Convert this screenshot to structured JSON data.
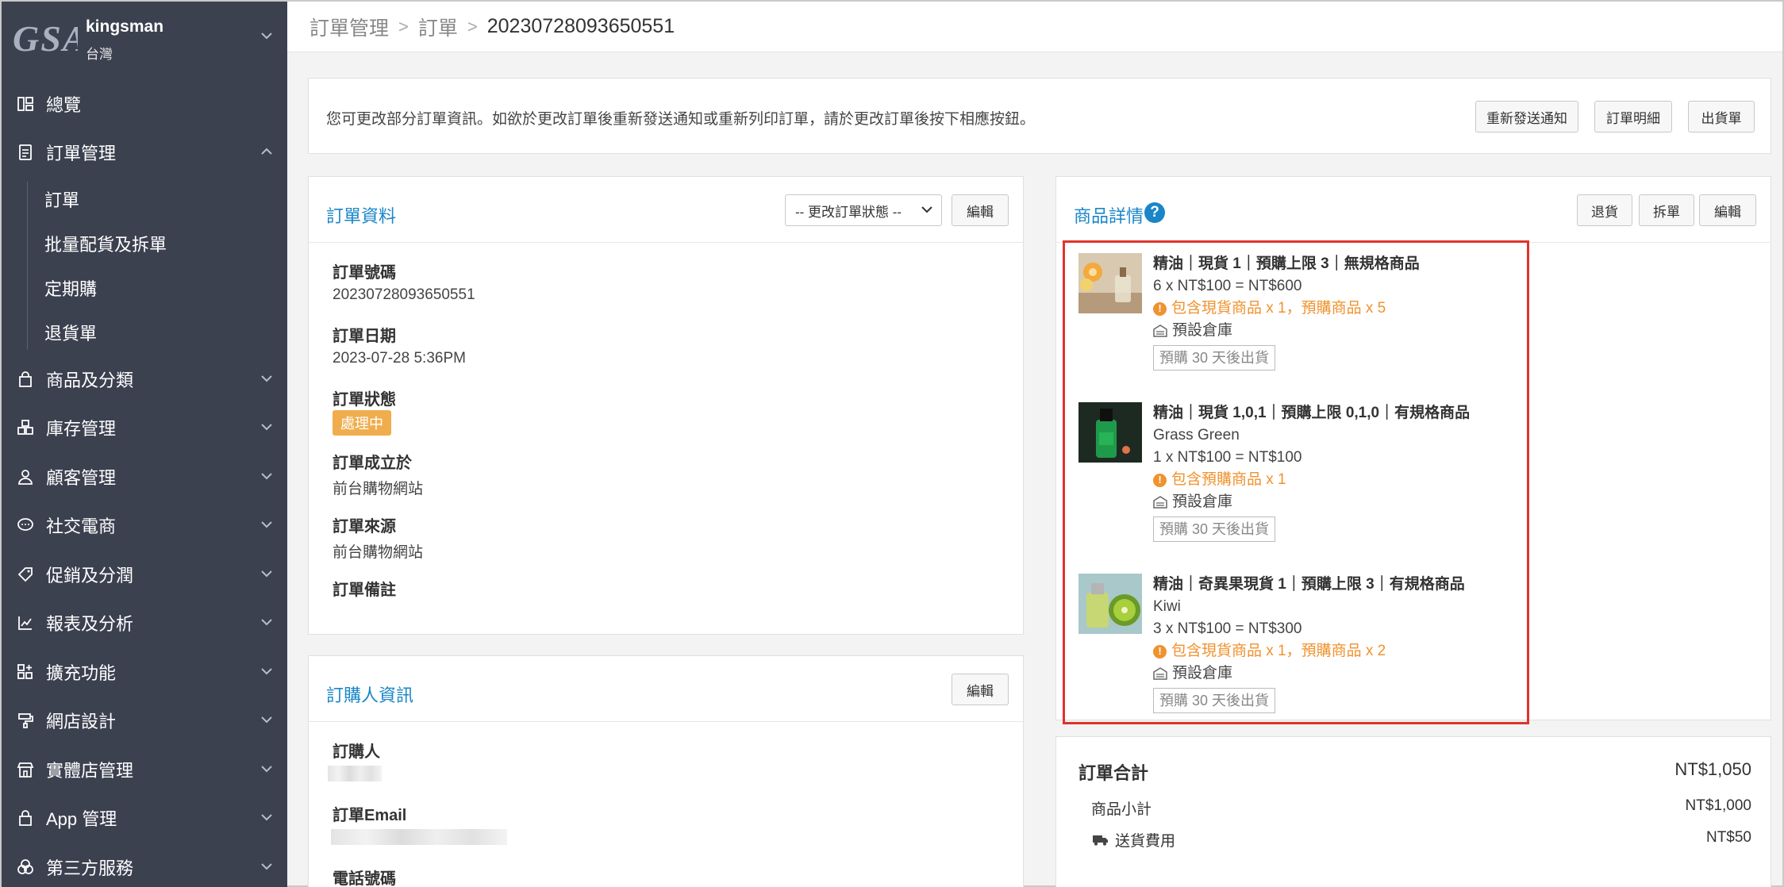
{
  "sidebar": {
    "logo_text": "GSA",
    "store_name": "kingsman",
    "store_region": "台灣",
    "items": [
      {
        "label": "總覽",
        "icon": "dashboard-icon"
      },
      {
        "label": "訂單管理",
        "icon": "clipboard-icon",
        "expanded": true
      },
      {
        "label": "商品及分類",
        "icon": "bag-icon"
      },
      {
        "label": "庫存管理",
        "icon": "boxes-icon"
      },
      {
        "label": "顧客管理",
        "icon": "user-icon"
      },
      {
        "label": "社交電商",
        "icon": "chat-icon"
      },
      {
        "label": "促銷及分潤",
        "icon": "tag-icon"
      },
      {
        "label": "報表及分析",
        "icon": "chart-icon"
      },
      {
        "label": "擴充功能",
        "icon": "puzzle-icon"
      },
      {
        "label": "網店設計",
        "icon": "paint-roller-icon"
      },
      {
        "label": "實體店管理",
        "icon": "store-icon"
      },
      {
        "label": "App 管理",
        "icon": "lock-bag-icon"
      },
      {
        "label": "第三方服務",
        "icon": "circles-icon"
      }
    ],
    "sub_items": [
      "訂單",
      "批量配貨及拆單",
      "定期購",
      "退貨單"
    ]
  },
  "breadcrumb": {
    "level1": "訂單管理",
    "level2": "訂單",
    "current": "20230728093650551"
  },
  "notice": {
    "message": "您可更改部分訂單資訊。如欲於更改訂單後重新發送通知或重新列印訂單，請於更改訂單後按下相應按鈕。",
    "buttons": [
      "重新發送通知",
      "訂單明細",
      "出貨單"
    ]
  },
  "order_info": {
    "title": "訂單資料",
    "status_select": "-- 更改訂單狀態 --",
    "edit_label": "編輯",
    "order_no_label": "訂單號碼",
    "order_no": "20230728093650551",
    "date_label": "訂單日期",
    "date": "2023-07-28 5:36PM",
    "status_label": "訂單狀態",
    "status": "處理中",
    "created_at_label": "訂單成立於",
    "created_at": "前台購物網站",
    "source_label": "訂單來源",
    "source": "前台購物網站",
    "note_label": "訂單備註"
  },
  "buyer_info": {
    "title": "訂購人資訊",
    "edit_label": "編輯",
    "name_label": "訂購人",
    "email_label": "訂單Email",
    "phone_label": "電話號碼"
  },
  "products": {
    "title": "商品詳情",
    "buttons": [
      "退貨",
      "拆單",
      "編輯"
    ],
    "items": [
      {
        "name": "精油｜現貨 1｜預購上限 3｜無規格商品",
        "variant": "",
        "price_line": "6 x NT$100 = NT$600",
        "warning": "包含現貨商品 x 1，預購商品 x 5",
        "warehouse": "預設倉庫",
        "tag": "預購 30 天後出貨"
      },
      {
        "name": "精油｜現貨 1,0,1｜預購上限 0,1,0｜有規格商品",
        "variant": "Grass Green",
        "price_line": "1 x NT$100 = NT$100",
        "warning": "包含預購商品 x 1",
        "warehouse": "預設倉庫",
        "tag": "預購 30 天後出貨"
      },
      {
        "name": "精油｜奇異果現貨 1｜預購上限 3｜有規格商品",
        "variant": "Kiwi",
        "price_line": "3 x NT$100 = NT$300",
        "warning": "包含現貨商品 x 1，預購商品 x 2",
        "warehouse": "預設倉庫",
        "tag": "預購 30 天後出貨"
      }
    ]
  },
  "totals": {
    "total_label": "訂單合計",
    "total": "NT$1,050",
    "subtotal_label": "商品小計",
    "subtotal": "NT$1,000",
    "shipping_label": "送貨費用",
    "shipping": "NT$50"
  },
  "colors": {
    "sidebar_bg": "#3c4150",
    "accent_blue": "#1a86c8",
    "status_orange": "#f0ad4e",
    "warning_orange": "#f0922e",
    "highlight_red": "#e0332b"
  }
}
